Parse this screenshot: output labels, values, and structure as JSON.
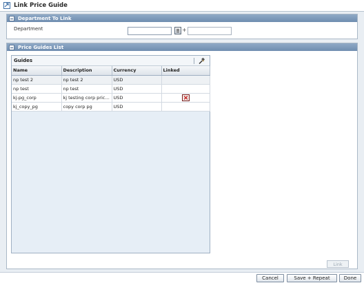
{
  "window": {
    "title": "Link Price Guide",
    "app_icon": "link-window-icon"
  },
  "department_panel": {
    "header": "Department To Link",
    "department_label": "Department",
    "department_value": "",
    "lookup_icon": "lookup-list-icon",
    "plus": "+"
  },
  "guides_panel": {
    "header": "Price Guides List",
    "grid": {
      "title": "Guides",
      "edit_icon": "edit-hammer-icon",
      "columns": [
        "Name",
        "Description",
        "Currency",
        "Linked"
      ],
      "rows": [
        {
          "name": "np test 2",
          "description": "np test 2",
          "currency": "USD",
          "linked": ""
        },
        {
          "name": "np test",
          "description": "np test",
          "currency": "USD",
          "linked": ""
        },
        {
          "name": "kj-pg_corp",
          "description": "kj testing corp price...",
          "currency": "USD",
          "linked": "x"
        },
        {
          "name": "kj_copy_pg",
          "description": "copy corp pg",
          "currency": "USD",
          "linked": ""
        }
      ]
    },
    "link_button": "Link"
  },
  "footer": {
    "cancel": "Cancel",
    "save_repeat": "Save + Repeat",
    "done": "Done"
  },
  "colors": {
    "panel_header": "#7f9bbd",
    "content_bg": "#e9eef3",
    "grid_bg": "#e6eef6",
    "linked_x": "#c62828"
  }
}
